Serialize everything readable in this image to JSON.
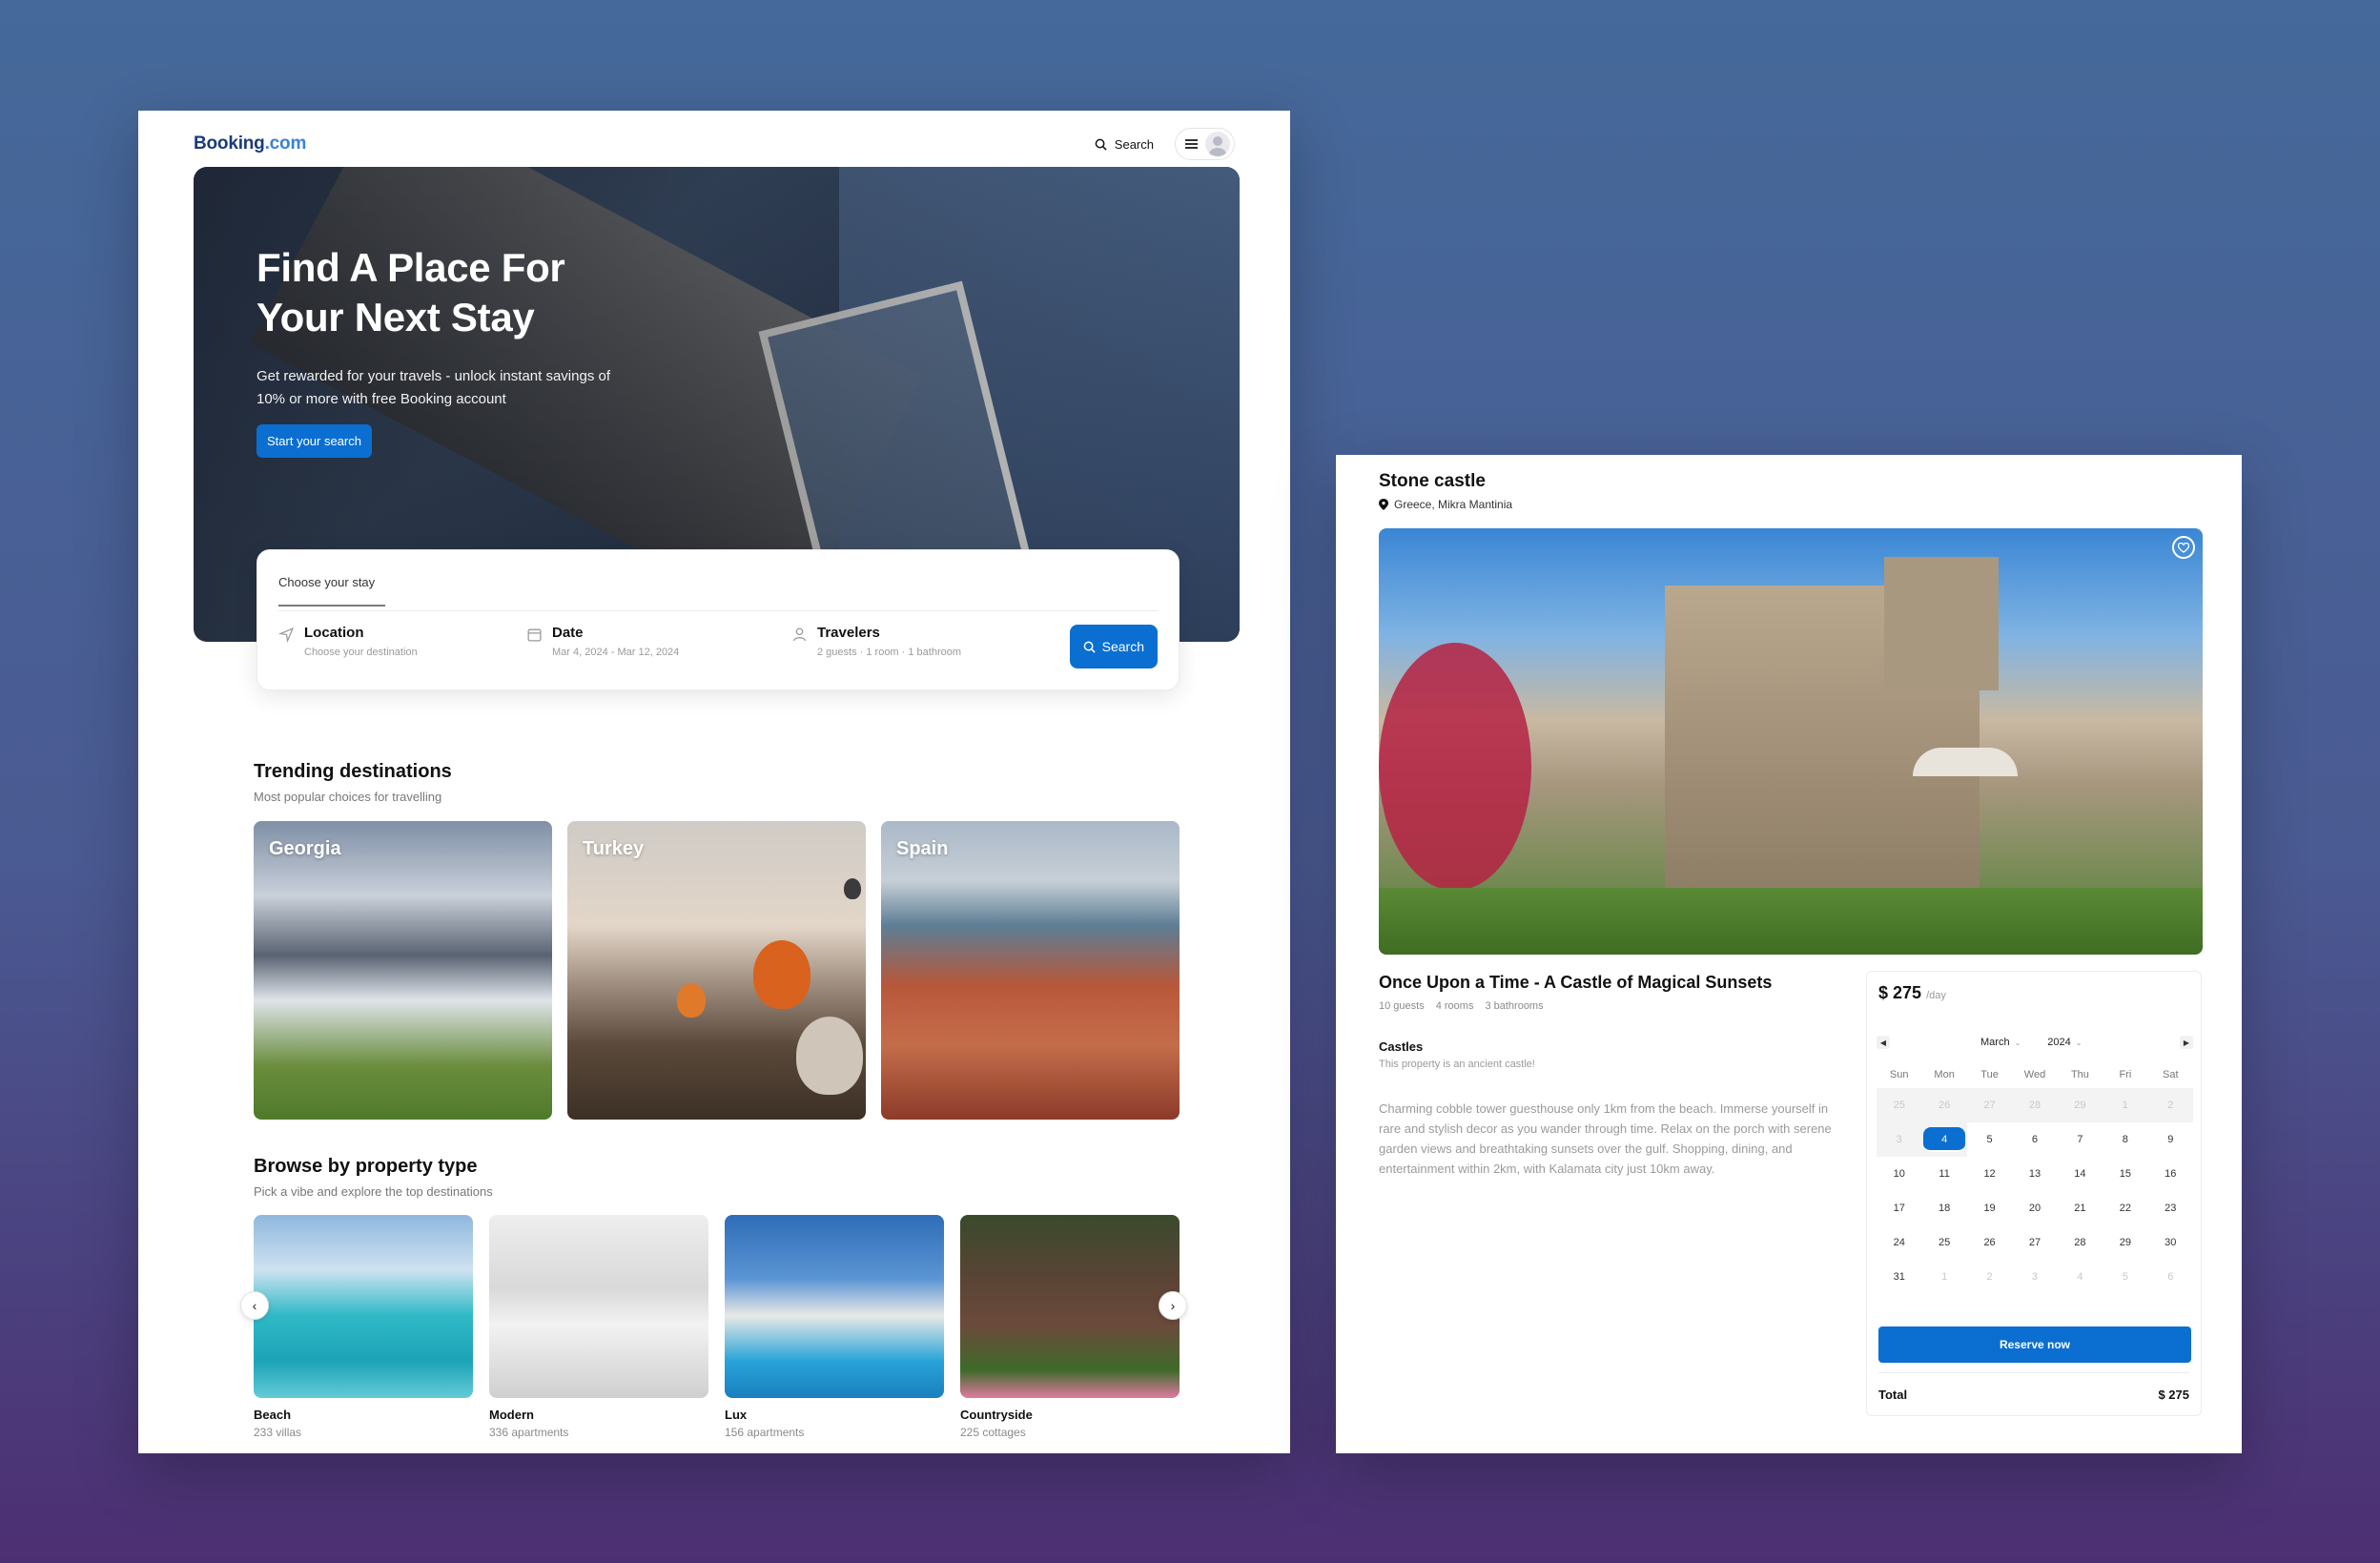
{
  "header": {
    "logo_main": "Booking",
    "logo_dot": ".com",
    "search_label": "Search"
  },
  "hero": {
    "title_line1": "Find A Place For",
    "title_line2": "Your Next Stay",
    "subtitle": "Get rewarded for your travels - unlock instant savings of 10% or more with free Booking account",
    "cta": "Start your search"
  },
  "search_panel": {
    "tab": "Choose your stay",
    "location_label": "Location",
    "location_value": "Choose your destination",
    "date_label": "Date",
    "date_value": "Mar 4, 2024 - Mar 12, 2024",
    "travelers_label": "Travelers",
    "travelers_value": "2 guests · 1 room · 1 bathroom",
    "button": "Search"
  },
  "trending": {
    "title": "Trending destinations",
    "subtitle": "Most popular choices for travelling",
    "items": [
      {
        "name": "Georgia"
      },
      {
        "name": "Turkey"
      },
      {
        "name": "Spain"
      }
    ]
  },
  "property_types": {
    "title": "Browse by property type",
    "subtitle": "Pick a vibe and explore the top destinations",
    "items": [
      {
        "name": "Beach",
        "count": "233 villas"
      },
      {
        "name": "Modern",
        "count": "336 apartments"
      },
      {
        "name": "Lux",
        "count": "156 apartments"
      },
      {
        "name": "Countryside",
        "count": "225 cottages"
      }
    ]
  },
  "listing": {
    "name": "Stone castle",
    "location": "Greece, Mikra Mantinia",
    "headline": "Once Upon a Time - A Castle of Magical Sunsets",
    "guests": "10 guests",
    "rooms": "4 rooms",
    "bathrooms": "3 bathrooms",
    "category": "Castles",
    "category_note": "This property is an ancient castle!",
    "description": "Charming cobble tower guesthouse only 1km from the beach. Immerse yourself in rare and stylish decor as you wander through time. Relax on the porch with serene garden views and breathtaking sunsets over the gulf. Shopping, dining, and entertainment within 2km, with Kalamata city just 10km away."
  },
  "booking": {
    "price": "$ 275",
    "per": "/day",
    "month": "March",
    "year": "2024",
    "weekdays": [
      "Sun",
      "Mon",
      "Tue",
      "Wed",
      "Thu",
      "Fri",
      "Sat"
    ],
    "days": [
      {
        "d": "25",
        "muted": true,
        "band": true
      },
      {
        "d": "26",
        "muted": true,
        "band": true
      },
      {
        "d": "27",
        "muted": true,
        "band": true
      },
      {
        "d": "28",
        "muted": true,
        "band": true
      },
      {
        "d": "29",
        "muted": true,
        "band": true
      },
      {
        "d": "1",
        "muted": true,
        "band": true
      },
      {
        "d": "2",
        "muted": true,
        "band": true
      },
      {
        "d": "3",
        "muted": true,
        "band": true
      },
      {
        "d": "4",
        "selected": true,
        "band": true
      },
      {
        "d": "5"
      },
      {
        "d": "6"
      },
      {
        "d": "7"
      },
      {
        "d": "8"
      },
      {
        "d": "9"
      },
      {
        "d": "10"
      },
      {
        "d": "11"
      },
      {
        "d": "12"
      },
      {
        "d": "13"
      },
      {
        "d": "14"
      },
      {
        "d": "15"
      },
      {
        "d": "16"
      },
      {
        "d": "17"
      },
      {
        "d": "18"
      },
      {
        "d": "19"
      },
      {
        "d": "20"
      },
      {
        "d": "21"
      },
      {
        "d": "22"
      },
      {
        "d": "23"
      },
      {
        "d": "24"
      },
      {
        "d": "25"
      },
      {
        "d": "26"
      },
      {
        "d": "27"
      },
      {
        "d": "28"
      },
      {
        "d": "29"
      },
      {
        "d": "30"
      },
      {
        "d": "31"
      },
      {
        "d": "1",
        "muted": true
      },
      {
        "d": "2",
        "muted": true
      },
      {
        "d": "3",
        "muted": true
      },
      {
        "d": "4",
        "muted": true
      },
      {
        "d": "5",
        "muted": true
      },
      {
        "d": "6",
        "muted": true
      }
    ],
    "reserve": "Reserve now",
    "total_label": "Total",
    "total_value": "$ 275"
  },
  "colors": {
    "accent": "#0a6fd1",
    "logo": "#1a3b7a",
    "background_top": "#45699a",
    "background_bottom": "#4c2f72"
  },
  "icons": [
    "search-icon",
    "menu-icon",
    "avatar-icon",
    "location-arrow-icon",
    "calendar-icon",
    "person-icon",
    "chevron-left-icon",
    "chevron-right-icon",
    "pin-icon",
    "heart-icon"
  ]
}
